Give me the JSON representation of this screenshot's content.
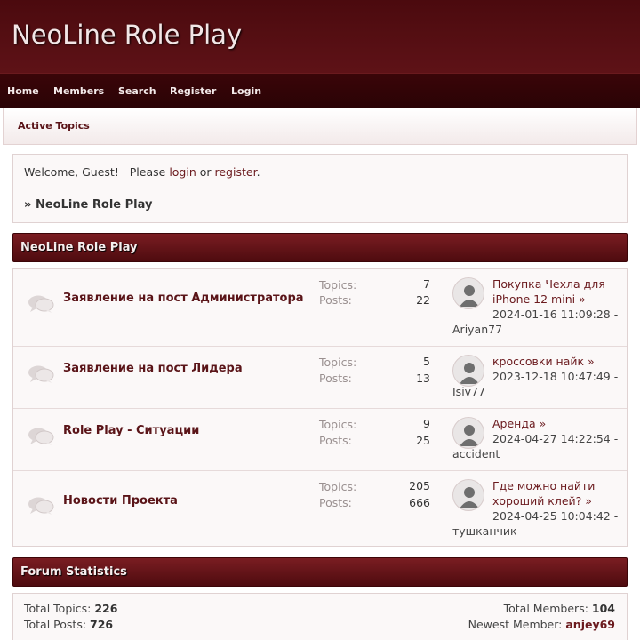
{
  "site": {
    "title": "NeoLine Role Play"
  },
  "nav": {
    "items": [
      "Home",
      "Members",
      "Search",
      "Register",
      "Login"
    ]
  },
  "subnav": {
    "active_topics": "Active Topics"
  },
  "welcome": {
    "prefix": "Welcome, Guest!   Please ",
    "login": "login",
    "or": " or ",
    "register": "register",
    "suffix": ".",
    "breadcrumb_marker": "»",
    "breadcrumb": "NeoLine Role Play"
  },
  "category": {
    "title": "NeoLine Role Play"
  },
  "labels": {
    "topics": "Topics:",
    "posts": "Posts:"
  },
  "boards": [
    {
      "name": "Заявление на пост Администратора",
      "topics": "7",
      "posts": "22",
      "last_title": "Покупка Чехла для iPhone 12 mini",
      "last_date": "2024-01-16 11:09:28 -",
      "last_user": "Ariyan77",
      "icon": "user-avatar-icon"
    },
    {
      "name": "Заявление на пост Лидера",
      "topics": "5",
      "posts": "13",
      "last_title": "кроссовки найк",
      "last_date": "2023-12-18 10:47:49 -",
      "last_user": "Isiv77",
      "icon": "user-avatar-icon"
    },
    {
      "name": "Role Play - Ситуации",
      "topics": "9",
      "posts": "25",
      "last_title": "Аренда",
      "last_date": "2024-04-27 14:22:54 -",
      "last_user": "accident",
      "icon": "user-avatar-icon"
    },
    {
      "name": "Новости Проекта",
      "topics": "205",
      "posts": "666",
      "last_title": "Где можно найти хороший клей?",
      "last_date": "2024-04-25 10:04:42 -",
      "last_user": "тушканчик",
      "icon": "user-avatar-icon"
    }
  ],
  "stats": {
    "title": "Forum Statistics",
    "total_topics_label": "Total Topics:",
    "total_topics": "226",
    "total_posts_label": "Total Posts:",
    "total_posts": "726",
    "total_members_label": "Total Members:",
    "total_members": "104",
    "newest_member_label": "Newest Member:",
    "newest_member": "anjey69"
  },
  "colors": {
    "header_bg": "#4b0a0e",
    "accent": "#6b1a1e",
    "category_bar": "#7a1d22"
  }
}
